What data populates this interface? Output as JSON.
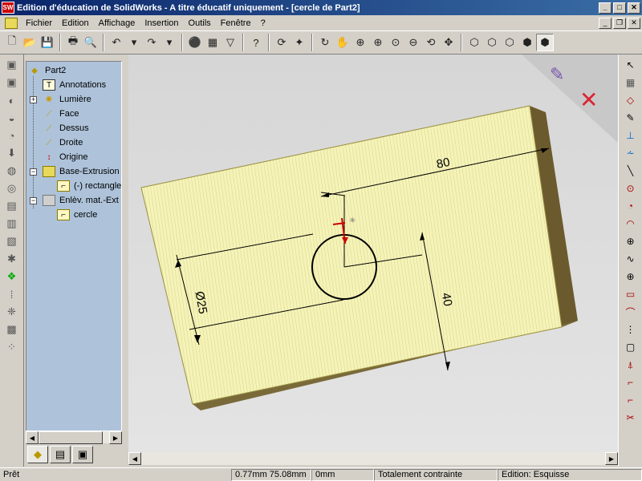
{
  "window": {
    "title": "Edition d'éducation de SolidWorks - A titre éducatif uniquement - [cercle de Part2]",
    "app_icon_text": "SW"
  },
  "menu": [
    "Fichier",
    "Edition",
    "Affichage",
    "Insertion",
    "Outils",
    "Fenêtre",
    "?"
  ],
  "tree": {
    "root": "Part2",
    "items": [
      {
        "label": "Annotations",
        "icon": "annotations-icon"
      },
      {
        "label": "Lumière",
        "icon": "light-icon"
      },
      {
        "label": "Face",
        "icon": "plane-icon"
      },
      {
        "label": "Dessus",
        "icon": "plane-icon"
      },
      {
        "label": "Droite",
        "icon": "plane-icon"
      },
      {
        "label": "Origine",
        "icon": "origin-icon"
      },
      {
        "label": "Base-Extrusion",
        "icon": "extrude-icon"
      },
      {
        "label": "(-) rectangle",
        "icon": "sketch-icon"
      },
      {
        "label": "Enlèv. mat.-Ext",
        "icon": "cut-extrude-icon"
      },
      {
        "label": "cercle",
        "icon": "sketch-icon"
      }
    ]
  },
  "drawing": {
    "dim_width": "80",
    "dim_height": "40",
    "dim_diameter": "Ø25",
    "face_color": "#f5f3b8",
    "edge_color": "#6b5a2e"
  },
  "status": {
    "ready": "Prêt",
    "coords": "0.77mm 75.08mm",
    "z": "0mm",
    "constraint": "Totalement contrainte",
    "mode": "Edition: Esquisse"
  }
}
